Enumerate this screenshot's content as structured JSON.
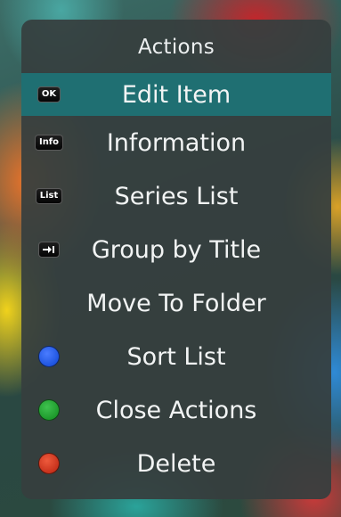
{
  "menu": {
    "title": "Actions",
    "items": [
      {
        "label": "Edit Item",
        "key": "OK",
        "icon": "ok-button-icon",
        "selected": true
      },
      {
        "label": "Information",
        "key": "Info",
        "icon": "info-button-icon"
      },
      {
        "label": "Series List",
        "key": "List",
        "icon": "list-button-icon"
      },
      {
        "label": "Group by Title",
        "key": "",
        "icon": "tab-arrow-button-icon"
      },
      {
        "label": "Move To Folder",
        "key": "",
        "icon": ""
      },
      {
        "label": "Sort List",
        "key": "",
        "icon": "blue-button-icon",
        "color": "#1f55e0"
      },
      {
        "label": "Close Actions",
        "key": "",
        "icon": "green-button-icon",
        "color": "#1e9a2c"
      },
      {
        "label": "Delete",
        "key": "",
        "icon": "red-button-icon",
        "color": "#c8321c"
      }
    ]
  },
  "colors": {
    "panel": "#363e3e",
    "highlight": "#1f6f72",
    "text": "#f2f4f4"
  }
}
